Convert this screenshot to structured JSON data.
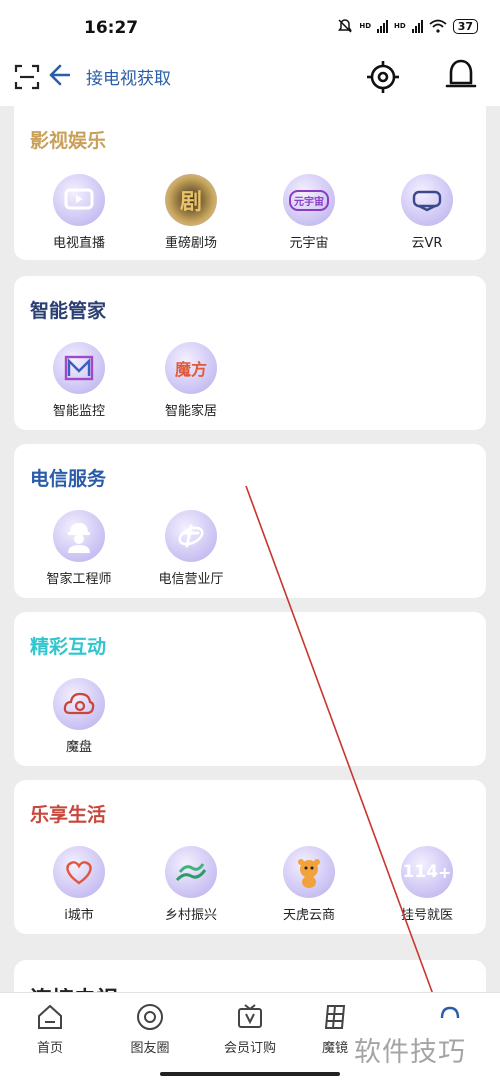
{
  "status_bar": {
    "time": "16:27",
    "battery": "37",
    "net1": "HD",
    "net2": "HD"
  },
  "top_bar": {
    "search_text": "接电视获取"
  },
  "sections": {
    "entertainment": {
      "title": "影视娱乐",
      "title_color": "#c9a05a",
      "items": [
        "电视直播",
        "重磅剧场",
        "元宇宙",
        "云VR"
      ]
    },
    "smart_home": {
      "title": "智能管家",
      "title_color": "#2b3f73",
      "items": [
        "智能监控",
        "智能家居"
      ]
    },
    "telecom": {
      "title": "电信服务",
      "title_color": "#2b5ca8",
      "items": [
        "智家工程师",
        "电信营业厅"
      ]
    },
    "interactive": {
      "title": "精彩互动",
      "title_color": "#2fc6cf",
      "items": [
        "魔盘"
      ]
    },
    "life": {
      "title": "乐享生活",
      "title_color": "#c8463c",
      "items": [
        "i城市",
        "乡村振兴",
        "天虎云商",
        "挂号就医"
      ]
    },
    "connect_tv": {
      "title": "连接电视"
    }
  },
  "icon_text": {
    "drama": "剧",
    "metaverse": "元宇宙",
    "magic_cube": "魔方",
    "hospital_num": "114"
  },
  "bottom_nav": [
    "首页",
    "图友圈",
    "会员订购",
    "魔镜",
    ""
  ],
  "watermark": "软件技巧",
  "colors": {
    "accent": "#2a5ea8",
    "arrow": "#c8372d"
  }
}
